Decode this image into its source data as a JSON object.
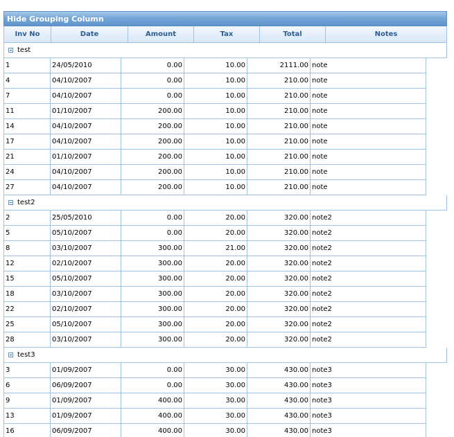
{
  "caption": "Hide Grouping Column",
  "columns": [
    "Inv No",
    "Date",
    "Amount",
    "Tax",
    "Total",
    "Notes"
  ],
  "groups": [
    {
      "name": "test",
      "rows": [
        [
          "1",
          "24/05/2010",
          "0.00",
          "10.00",
          "2111.00",
          "note"
        ],
        [
          "4",
          "04/10/2007",
          "0.00",
          "10.00",
          "210.00",
          "note"
        ],
        [
          "7",
          "04/10/2007",
          "0.00",
          "10.00",
          "210.00",
          "note"
        ],
        [
          "11",
          "01/10/2007",
          "200.00",
          "10.00",
          "210.00",
          "note"
        ],
        [
          "14",
          "04/10/2007",
          "200.00",
          "10.00",
          "210.00",
          "note"
        ],
        [
          "17",
          "04/10/2007",
          "200.00",
          "10.00",
          "210.00",
          "note"
        ],
        [
          "21",
          "01/10/2007",
          "200.00",
          "10.00",
          "210.00",
          "note"
        ],
        [
          "24",
          "04/10/2007",
          "200.00",
          "10.00",
          "210.00",
          "note"
        ],
        [
          "27",
          "04/10/2007",
          "200.00",
          "10.00",
          "210.00",
          "note"
        ]
      ]
    },
    {
      "name": "test2",
      "rows": [
        [
          "2",
          "25/05/2010",
          "0.00",
          "20.00",
          "320.00",
          "note2"
        ],
        [
          "5",
          "05/10/2007",
          "0.00",
          "20.00",
          "320.00",
          "note2"
        ],
        [
          "8",
          "03/10/2007",
          "300.00",
          "21.00",
          "320.00",
          "note2"
        ],
        [
          "12",
          "02/10/2007",
          "300.00",
          "20.00",
          "320.00",
          "note2"
        ],
        [
          "15",
          "05/10/2007",
          "300.00",
          "20.00",
          "320.00",
          "note2"
        ],
        [
          "18",
          "03/10/2007",
          "300.00",
          "20.00",
          "320.00",
          "note2"
        ],
        [
          "22",
          "02/10/2007",
          "300.00",
          "20.00",
          "320.00",
          "note2"
        ],
        [
          "25",
          "05/10/2007",
          "300.00",
          "20.00",
          "320.00",
          "note2"
        ],
        [
          "28",
          "03/10/2007",
          "300.00",
          "20.00",
          "320.00",
          "note2"
        ]
      ]
    },
    {
      "name": "test3",
      "rows": [
        [
          "3",
          "01/09/2007",
          "0.00",
          "30.00",
          "430.00",
          "note3"
        ],
        [
          "6",
          "06/09/2007",
          "0.00",
          "30.00",
          "430.00",
          "note3"
        ],
        [
          "9",
          "01/09/2007",
          "400.00",
          "30.00",
          "430.00",
          "note3"
        ],
        [
          "13",
          "01/09/2007",
          "400.00",
          "30.00",
          "430.00",
          "note3"
        ],
        [
          "16",
          "06/09/2007",
          "400.00",
          "30.00",
          "430.00",
          "note3"
        ]
      ]
    }
  ]
}
